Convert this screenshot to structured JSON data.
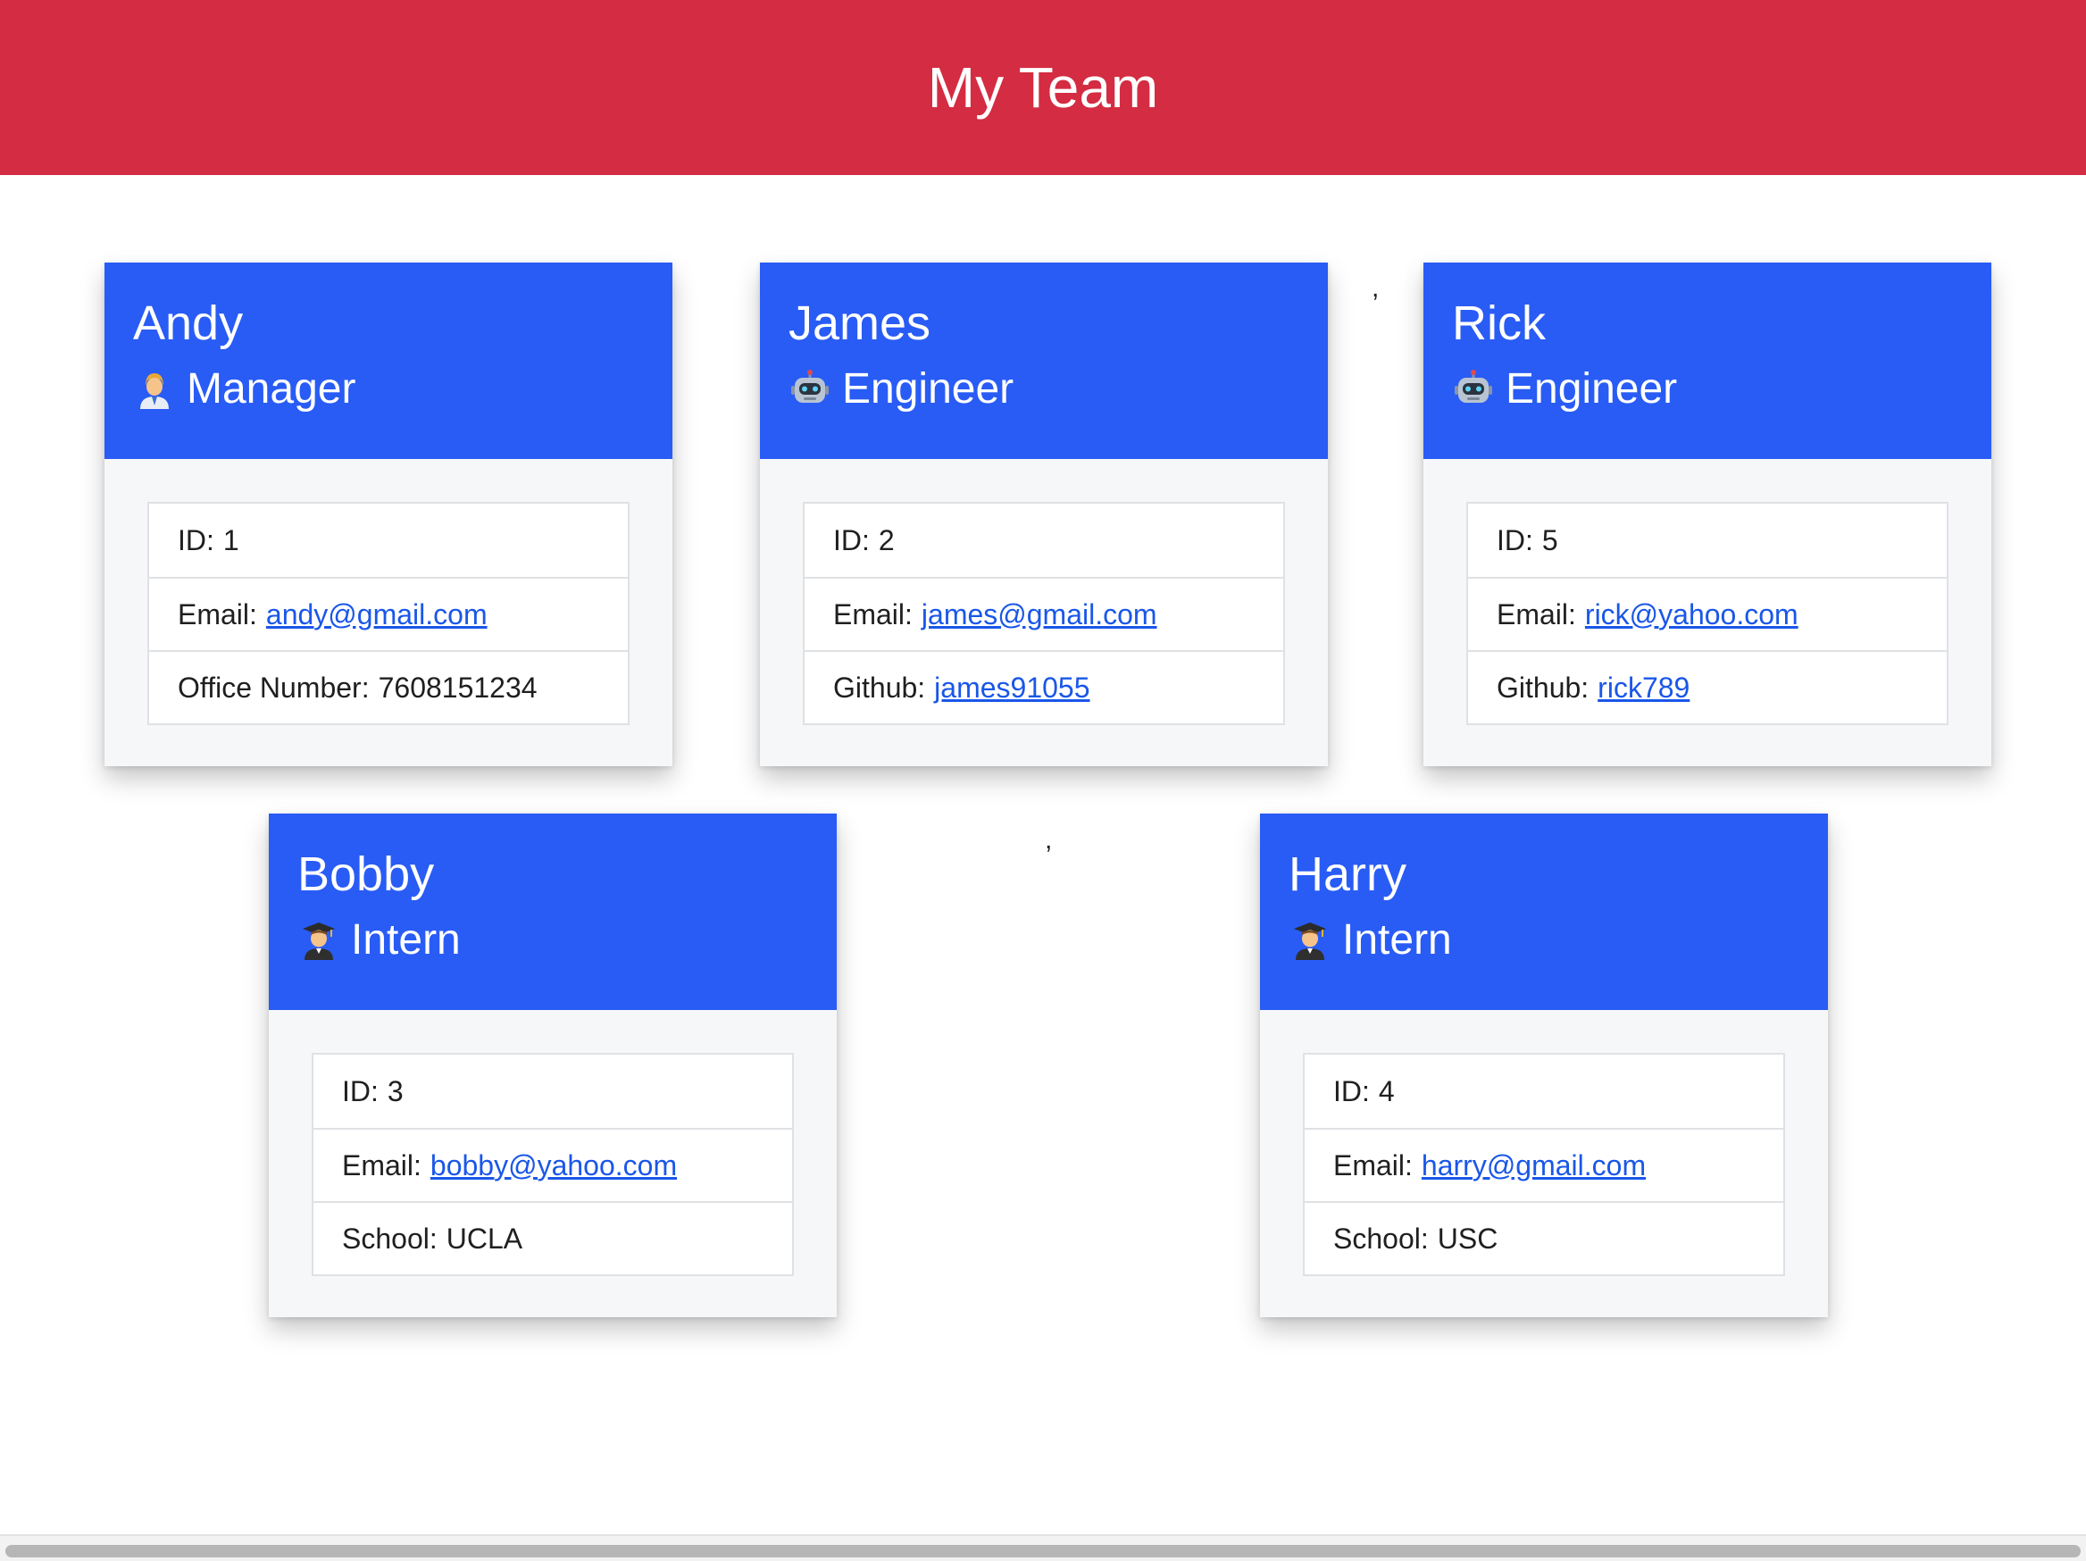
{
  "header": {
    "title": "My Team"
  },
  "stray_marks": [
    ",",
    ","
  ],
  "team": [
    {
      "name": "Andy",
      "role": "Manager",
      "role_icon": "manager-icon",
      "id_label": "ID:",
      "id": "1",
      "email_label": "Email:",
      "email": "andy@gmail.com",
      "extra_label": "Office Number:",
      "extra": "7608151234"
    },
    {
      "name": "James",
      "role": "Engineer",
      "role_icon": "robot-icon",
      "id_label": "ID:",
      "id": "2",
      "email_label": "Email:",
      "email": "james@gmail.com",
      "extra_label": "Github:",
      "extra": "james91055"
    },
    {
      "name": "Rick",
      "role": "Engineer",
      "role_icon": "robot-icon",
      "id_label": "ID:",
      "id": "5",
      "email_label": "Email:",
      "email": "rick@yahoo.com",
      "extra_label": "Github:",
      "extra": "rick789"
    },
    {
      "name": "Bobby",
      "role": "Intern",
      "role_icon": "student-icon",
      "id_label": "ID:",
      "id": "3",
      "email_label": "Email:",
      "email": "bobby@yahoo.com",
      "extra_label": "School:",
      "extra": "UCLA"
    },
    {
      "name": "Harry",
      "role": "Intern",
      "role_icon": "student-icon",
      "id_label": "ID:",
      "id": "4",
      "email_label": "Email:",
      "email": "harry@gmail.com",
      "extra_label": "School:",
      "extra": "USC"
    }
  ],
  "colors": {
    "header_bg": "#d42c42",
    "card_header_bg": "#295cf5",
    "link": "#1a57e8"
  }
}
